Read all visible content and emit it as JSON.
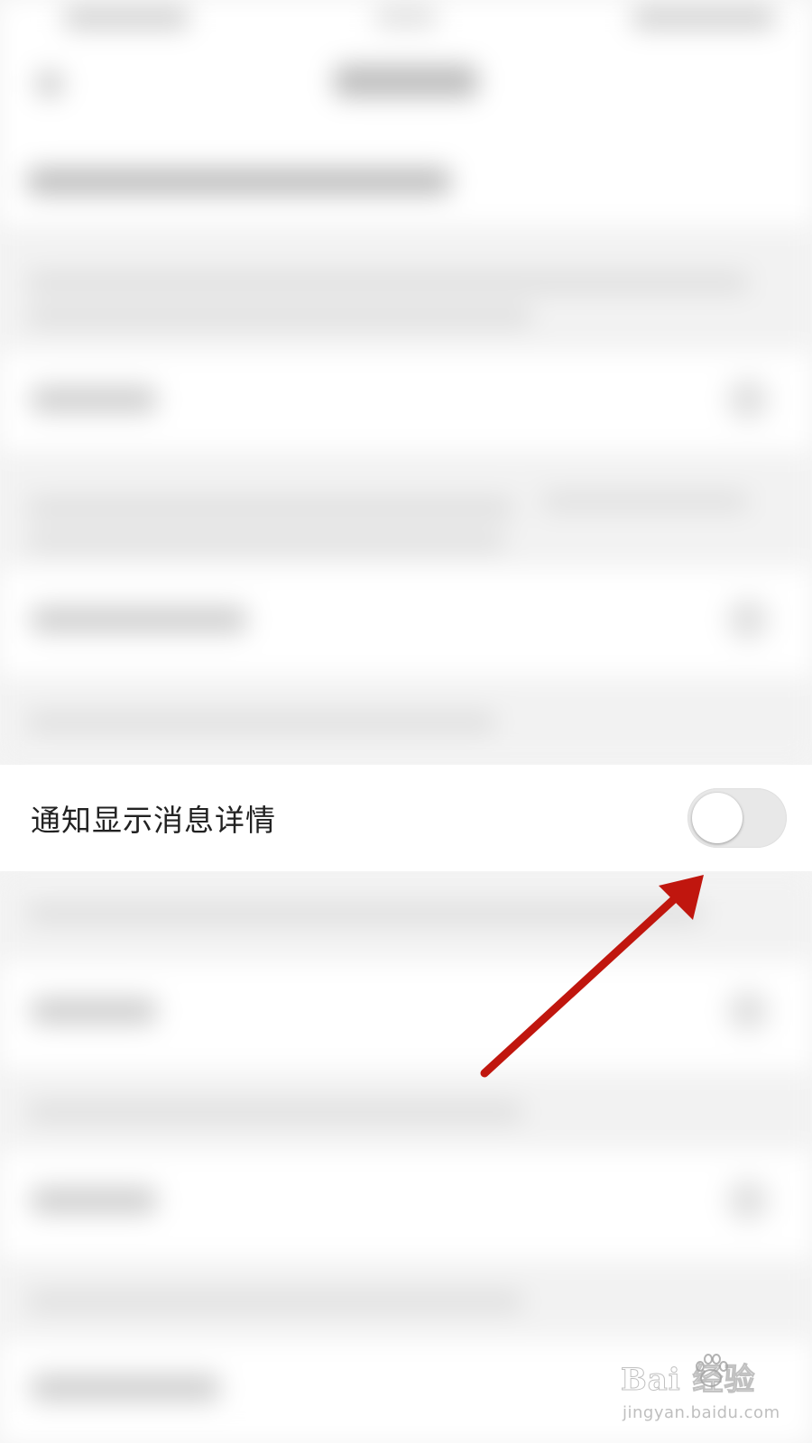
{
  "setting": {
    "label": "通知显示消息详情",
    "enabled": false
  },
  "annotation": {
    "arrow_color": "#c0160e"
  },
  "watermark": {
    "brand": "Bai  经验",
    "url": "jingyan.baidu.com"
  }
}
